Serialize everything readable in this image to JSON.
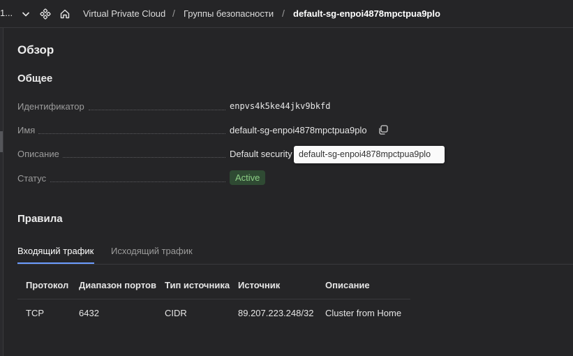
{
  "topbar": {
    "truncated_text": "1...",
    "breadcrumbs": [
      {
        "label": "Virtual Private Cloud"
      },
      {
        "label": "Группы безопасности"
      },
      {
        "label": "default-sg-enpoi4878mpctpua9plo"
      }
    ],
    "separator": "/"
  },
  "overview": {
    "title": "Обзор",
    "general_title": "Общее",
    "properties": {
      "id": {
        "label": "Идентификатор",
        "value": "enpvs4k5ke44jkv9bkfd"
      },
      "name": {
        "label": "Имя",
        "value": "default-sg-enpoi4878mpctpua9plo"
      },
      "description": {
        "label": "Описание",
        "value": "Default security"
      },
      "status": {
        "label": "Статус",
        "value": "Active"
      }
    },
    "tooltip": "default-sg-enpoi4878mpctpua9plo"
  },
  "rules": {
    "title": "Правила",
    "tabs": [
      {
        "label": "Входящий трафик",
        "active": true
      },
      {
        "label": "Исходящий трафик",
        "active": false
      }
    ],
    "columns": [
      "Протокол",
      "Диапазон портов",
      "Тип источника",
      "Источник",
      "Описание"
    ],
    "rows": [
      [
        "TCP",
        "6432",
        "CIDR",
        "89.207.223.248/32",
        "Cluster from Home"
      ]
    ]
  },
  "colors": {
    "background": "#252527",
    "accent": "#6b9cff",
    "status_active_bg": "#2f4a33",
    "status_active_text": "#8dcf86"
  },
  "icons": [
    "chevron-down-icon",
    "services-icon",
    "home-icon",
    "copy-icon"
  ]
}
